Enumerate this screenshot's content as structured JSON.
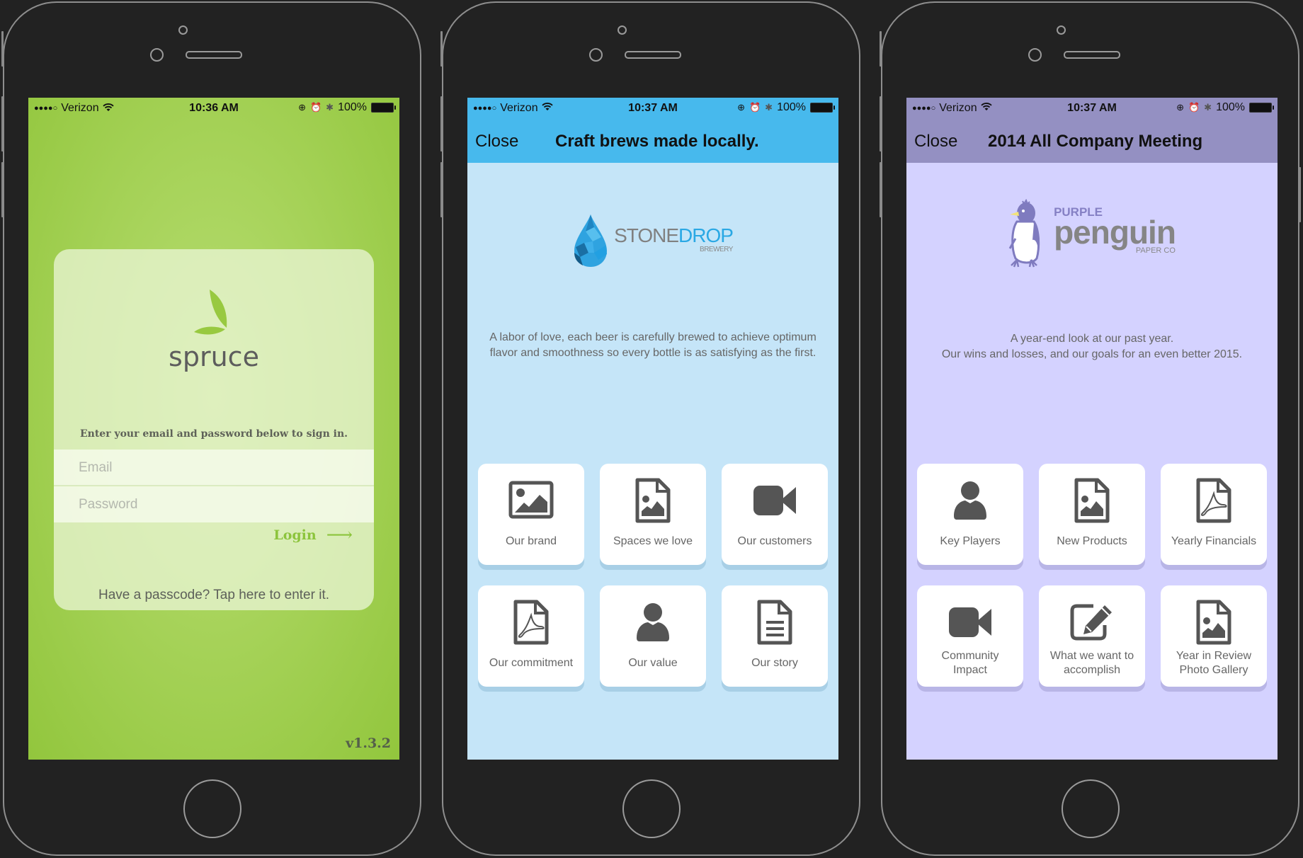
{
  "phones": [
    {
      "app": "spruce",
      "status_bar": {
        "carrier": "Verizon",
        "signal_dots": "●●●●○",
        "time": "10:36 AM",
        "battery": "100%"
      },
      "logo_text": "spruce",
      "signin_hint": "Enter your email and password below to sign in.",
      "email_placeholder": "Email",
      "password_placeholder": "Password",
      "login_label": "Login",
      "login_arrow": "⟶",
      "passcode_link": "Have a passcode? Tap here to enter it.",
      "version": "v1.3.2",
      "colors": {
        "accent": "#8cc43c",
        "background": "#a7d35a"
      }
    },
    {
      "app": "stonedrop",
      "status_bar": {
        "carrier": "Verizon",
        "signal_dots": "●●●●○",
        "time": "10:37 AM",
        "battery": "100%"
      },
      "header": {
        "close_label": "Close",
        "title": "Craft brews made locally."
      },
      "logo": {
        "word_a": "STONE",
        "word_b": "DROP",
        "subtitle": "BREWERY"
      },
      "description": [
        "A labor of love, each beer is carefully brewed to achieve optimum flavor and smoothness so every bottle is as satisfying as the first."
      ],
      "tiles": [
        {
          "label": "Our brand",
          "icon": "image-icon"
        },
        {
          "label": "Spaces we love",
          "icon": "image-file-icon"
        },
        {
          "label": "Our customers",
          "icon": "video-camera-icon"
        },
        {
          "label": "Our commitment",
          "icon": "pdf-file-icon"
        },
        {
          "label": "Our value",
          "icon": "user-icon"
        },
        {
          "label": "Our story",
          "icon": "text-document-icon"
        }
      ],
      "colors": {
        "header": "#47b9ed",
        "background": "#c5e5f8"
      }
    },
    {
      "app": "purple-penguin",
      "status_bar": {
        "carrier": "Verizon",
        "signal_dots": "●●●●○",
        "time": "10:37 AM",
        "battery": "100%"
      },
      "header": {
        "close_label": "Close",
        "title": "2014 All Company Meeting"
      },
      "logo": {
        "word_a": "PURPLE",
        "word_b": "penguin",
        "subtitle": "PAPER CO"
      },
      "description": [
        "A year-end look at our past year.",
        "Our wins and losses, and our goals for an even better 2015."
      ],
      "tiles": [
        {
          "label": "Key Players",
          "icon": "user-icon"
        },
        {
          "label": "New Products",
          "icon": "image-file-icon"
        },
        {
          "label": "Yearly Financials",
          "icon": "pdf-file-icon"
        },
        {
          "label": "Community Impact",
          "icon": "video-camera-icon"
        },
        {
          "label": "What we want to accomplish",
          "icon": "edit-pencil-icon"
        },
        {
          "label": "Year in Review Photo Gallery",
          "icon": "image-file-icon"
        }
      ],
      "colors": {
        "header": "#9490c2",
        "background": "#d4d2ff"
      }
    }
  ]
}
